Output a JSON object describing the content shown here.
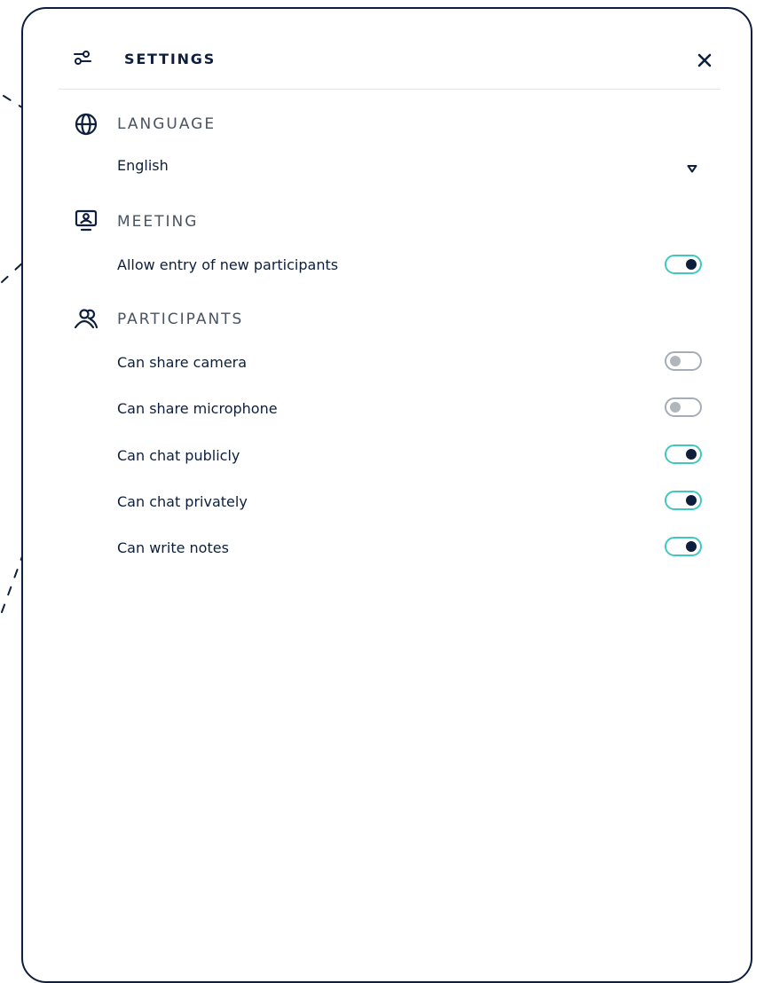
{
  "header": {
    "title": "SETTINGS"
  },
  "language": {
    "title": "LANGUAGE",
    "selected": "English"
  },
  "meeting": {
    "title": "MEETING",
    "allow_entry": {
      "label": "Allow entry of new participants",
      "on": true
    }
  },
  "participants": {
    "title": "PARTICIPANTS",
    "items": [
      {
        "label": "Can share camera",
        "on": false
      },
      {
        "label": "Can share microphone",
        "on": false
      },
      {
        "label": "Can chat publicly",
        "on": true
      },
      {
        "label": "Can chat privately",
        "on": true
      },
      {
        "label": "Can write notes",
        "on": true
      }
    ]
  },
  "colors": {
    "ink": "#0d1f3c",
    "toggle_on_border": "#40c8bf",
    "toggle_off_border": "#a6adb6",
    "muted_text": "#4a5362"
  }
}
